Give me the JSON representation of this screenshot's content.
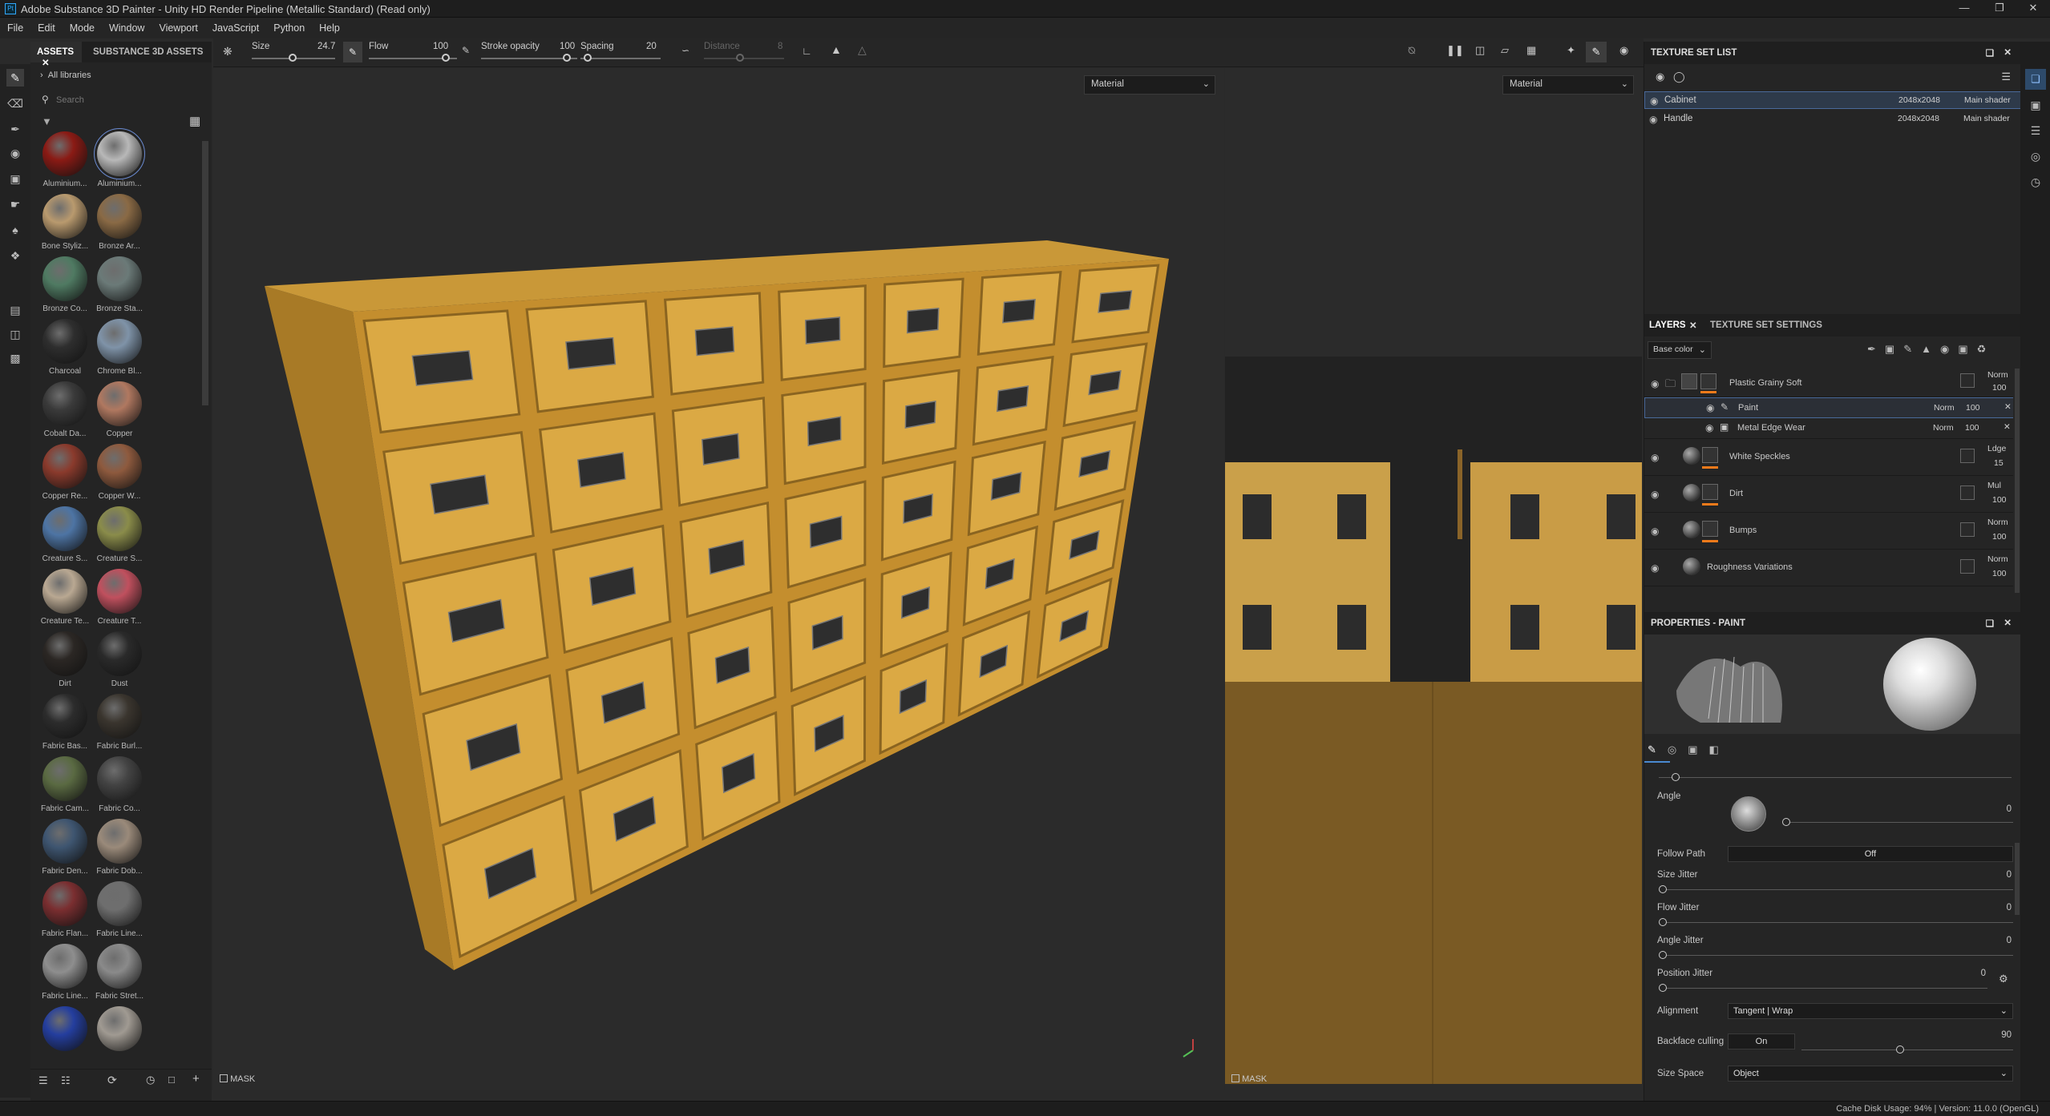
{
  "window": {
    "title": "Adobe Substance 3D Painter - Unity HD Render Pipeline (Metallic Standard) (Read only)",
    "app_badge": "Pt"
  },
  "menu": [
    "File",
    "Edit",
    "Mode",
    "Window",
    "Viewport",
    "JavaScript",
    "Python",
    "Help"
  ],
  "assets": {
    "tabs": [
      "ASSETS",
      "SUBSTANCE 3D ASSETS"
    ],
    "library": "All libraries",
    "search_placeholder": "Search",
    "materials": [
      {
        "label": "Aluminium...",
        "color": "#8a1a14"
      },
      {
        "label": "Aluminium...",
        "color": "#b8b8b8"
      },
      {
        "label": "Bone Styliz...",
        "color": "#b99a6e"
      },
      {
        "label": "Bronze Ar...",
        "color": "#8a6a45"
      },
      {
        "label": "Bronze Co...",
        "color": "#4f7a62"
      },
      {
        "label": "Bronze Sta...",
        "color": "#6b7a78"
      },
      {
        "label": "Charcoal",
        "color": "#2e2e2e"
      },
      {
        "label": "Chrome Bl...",
        "color": "#7f93a8"
      },
      {
        "label": "Cobalt Da...",
        "color": "#3a3a3a"
      },
      {
        "label": "Copper",
        "color": "#b07860"
      },
      {
        "label": "Copper Re...",
        "color": "#8a3a2c"
      },
      {
        "label": "Copper W...",
        "color": "#8e5a3e"
      },
      {
        "label": "Creature S...",
        "color": "#4d74a4"
      },
      {
        "label": "Creature S...",
        "color": "#8a8c4a"
      },
      {
        "label": "Creature Te...",
        "color": "#b9a892"
      },
      {
        "label": "Creature T...",
        "color": "#c0505e"
      },
      {
        "label": "Dirt",
        "color": "#2b2724"
      },
      {
        "label": "Dust",
        "color": "#2a2a2a"
      },
      {
        "label": "Fabric Bas...",
        "color": "#2c2c2c"
      },
      {
        "label": "Fabric Burl...",
        "color": "#3a352e"
      },
      {
        "label": "Fabric Cam...",
        "color": "#5a6a42"
      },
      {
        "label": "Fabric Co...",
        "color": "#434343"
      },
      {
        "label": "Fabric Den...",
        "color": "#3e5570"
      },
      {
        "label": "Fabric Dob...",
        "color": "#9a8a7a"
      },
      {
        "label": "Fabric Flan...",
        "color": "#7a2e30"
      },
      {
        "label": "Fabric Line...",
        "color": "#6e6e6e"
      },
      {
        "label": "Fabric Line...",
        "color": "#8e8e8e"
      },
      {
        "label": "Fabric Stret...",
        "color": "#8a8a8a"
      },
      {
        "label": "",
        "color": "#243e9e"
      },
      {
        "label": "",
        "color": "#a09a92"
      }
    ]
  },
  "toolbar": {
    "size_label": "Size",
    "size_value": "24.7",
    "flow_label": "Flow",
    "flow_value": "100",
    "stroke_opacity_label": "Stroke opacity",
    "stroke_opacity_value": "100",
    "spacing_label": "Spacing",
    "spacing_value": "20",
    "distance_label": "Distance",
    "distance_value": "8"
  },
  "viewport3d": {
    "mode": "Material",
    "mask_label": "MASK"
  },
  "viewport2d": {
    "mode": "Material",
    "mask_label": "MASK"
  },
  "texture_set_list": {
    "title": "TEXTURE SET LIST",
    "items": [
      {
        "name": "Cabinet",
        "res": "2048x2048",
        "shader": "Main shader"
      },
      {
        "name": "Handle",
        "res": "2048x2048",
        "shader": "Main shader"
      }
    ]
  },
  "layers": {
    "tabs": [
      "LAYERS",
      "TEXTURE SET SETTINGS"
    ],
    "channel": "Base color",
    "items": [
      {
        "name": "Plastic Grainy Soft",
        "blend": "Norm",
        "opacity": "100"
      },
      {
        "name": "Paint",
        "blend": "Norm",
        "opacity": "100"
      },
      {
        "name": "Metal Edge Wear",
        "blend": "Norm",
        "opacity": "100"
      },
      {
        "name": "White Speckles",
        "blend": "Ldge",
        "opacity": "15"
      },
      {
        "name": "Dirt",
        "blend": "Mul",
        "opacity": "100"
      },
      {
        "name": "Bumps",
        "blend": "Norm",
        "opacity": "100"
      },
      {
        "name": "Roughness Variations",
        "blend": "Norm",
        "opacity": "100"
      }
    ]
  },
  "properties": {
    "title": "PROPERTIES - PAINT",
    "angle_label": "Angle",
    "angle_value": "0",
    "follow_path_label": "Follow Path",
    "follow_path_value": "Off",
    "size_jitter_label": "Size Jitter",
    "size_jitter_value": "0",
    "flow_jitter_label": "Flow Jitter",
    "flow_jitter_value": "0",
    "angle_jitter_label": "Angle Jitter",
    "angle_jitter_value": "0",
    "position_jitter_label": "Position Jitter",
    "position_jitter_value": "0",
    "alignment_label": "Alignment",
    "alignment_value": "Tangent | Wrap",
    "backface_label": "Backface culling",
    "backface_value": "On",
    "backface_angle": "90",
    "size_space_label": "Size Space",
    "size_space_value": "Object"
  },
  "status": {
    "text": "Cache Disk Usage:  94% | Version: 11.0.0 (OpenGL)"
  }
}
